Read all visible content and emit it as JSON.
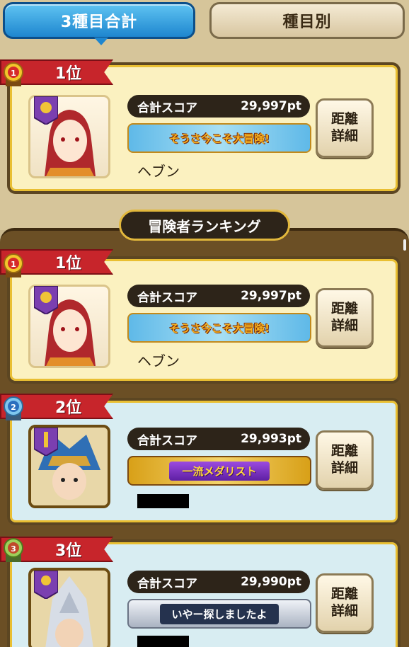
{
  "tabs": {
    "total_label": "3種目合計",
    "event_label": "種目別"
  },
  "my_entry": {
    "rank_label": "1位",
    "rank_number": "1",
    "score_label": "合計スコア",
    "score_value": "29,997pt",
    "title_badge": "そうさ今こそ大冒険!",
    "name": "ヘブン",
    "detail_button": "距離\n詳細"
  },
  "ranking_header": "冒険者ランキング",
  "ranking": [
    {
      "rank_label": "1位",
      "rank_number": "1",
      "score_label": "合計スコア",
      "score_value": "29,997pt",
      "title_badge": "そうさ今こそ大冒険!",
      "name": "ヘブン",
      "detail_button": "距離\n詳細"
    },
    {
      "rank_label": "2位",
      "rank_number": "2",
      "score_label": "合計スコア",
      "score_value": "29,993pt",
      "title_badge": "一流メダリスト",
      "detail_button": "距離\n詳細"
    },
    {
      "rank_label": "3位",
      "rank_number": "3",
      "score_label": "合計スコア",
      "score_value": "29,990pt",
      "title_badge": "いやー探しましたよ",
      "detail_button": "距離\n詳細"
    }
  ],
  "colors": {
    "tab_active": "#1e86cf",
    "rank_banner": "#c7252b",
    "card_gold": "#fbf1c0",
    "card_blue": "#d8edf2",
    "score_bar": "#2d2419"
  }
}
